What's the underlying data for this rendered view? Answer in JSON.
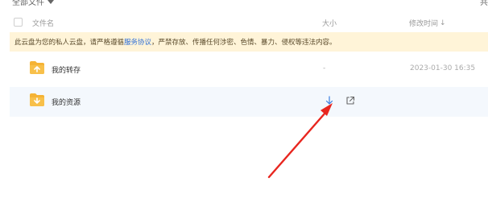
{
  "breadcrumb": {
    "label": "全部文件"
  },
  "top_right_glyph": "共",
  "header": {
    "name_label": "文件名",
    "size_label": "大小",
    "time_label": "修改时间",
    "sort_arrow": "↓"
  },
  "notice": {
    "text_before": "此云盘为您的私人云盘，请严格遵循",
    "link_text": "服务协议",
    "text_after": "，严禁存放、传播任何涉密、色情、暴力、侵权等违法内容。"
  },
  "files": [
    {
      "name": "我的转存",
      "size": "-",
      "modified": "2023-01-30 16:35"
    },
    {
      "name": "我的资源",
      "size": "",
      "modified": ""
    }
  ],
  "colors": {
    "notice_bg": "#fff4d8",
    "link": "#2f6fd6",
    "folder": "#f5b335",
    "selected_row": "#f4f8fd",
    "annotation_arrow": "#e8261f"
  },
  "icons": {
    "folder": "folder-icon",
    "download": "download-icon",
    "open": "open-external-icon",
    "checkbox": "checkbox-icon",
    "dropdown": "caret-down-icon"
  }
}
